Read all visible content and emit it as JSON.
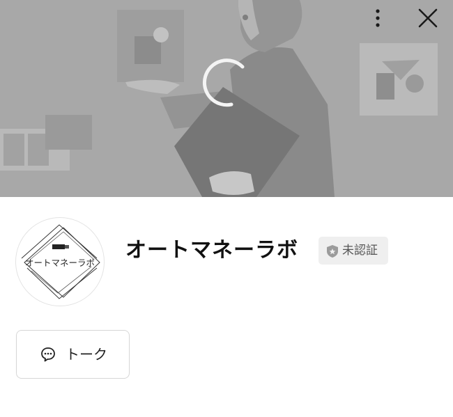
{
  "header": {
    "more_icon": "vertical-ellipsis-icon",
    "close_icon": "close-icon",
    "loading_icon": "loading-spinner-icon"
  },
  "profile": {
    "avatar_text": "オートマネーラボ",
    "name": "オートマネーラボ",
    "badge_label": "未認証",
    "badge_icon": "shield-star-icon"
  },
  "actions": {
    "talk_label": "トーク",
    "talk_icon": "chat-bubble-icon"
  }
}
